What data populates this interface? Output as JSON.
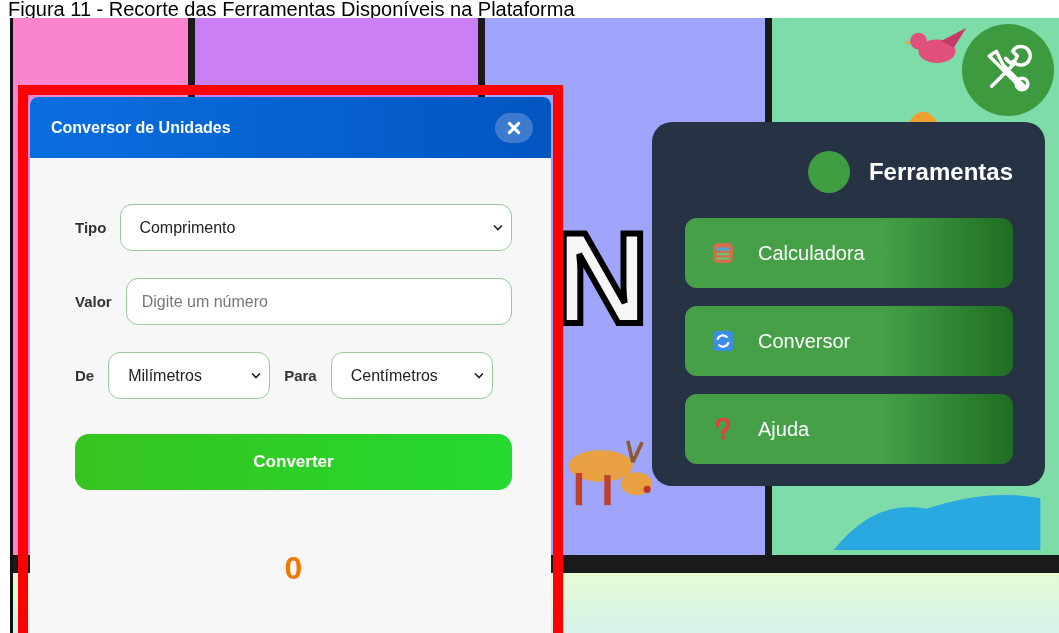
{
  "caption": "Figura 11 - Recorte das Ferramentas Disponíveis na Plataforma",
  "background": {
    "heading_fragment": "N"
  },
  "converter_dialog": {
    "title": "Conversor de Unidades",
    "fields": [
      {
        "kind": "select",
        "label": "Tipo",
        "value": "Comprimento"
      },
      {
        "kind": "input",
        "label": "Valor",
        "placeholder": "Digite um número"
      }
    ],
    "units": [
      {
        "label": "De",
        "value": "Milímetros"
      },
      {
        "label": "Para",
        "value": "Centímetros"
      }
    ],
    "button": "Converter",
    "result": "0"
  },
  "tools_panel": {
    "title": "Ferramentas",
    "items": [
      {
        "kind": "calculator",
        "label": "Calculadora"
      },
      {
        "kind": "converter",
        "label": "Conversor"
      },
      {
        "kind": "help",
        "label": "Ajuda"
      }
    ]
  }
}
